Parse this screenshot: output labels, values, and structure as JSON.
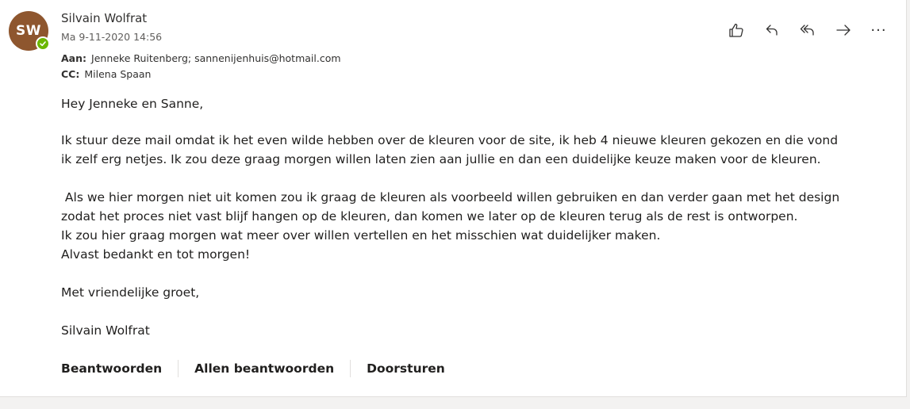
{
  "sender": {
    "initials": "SW",
    "name": "Silvain Wolfrat",
    "date": "Ma 9-11-2020 14:56",
    "avatar_color": "#8e562e",
    "presence_color": "#6bb700"
  },
  "recipients": {
    "to_label": "Aan:",
    "to": "Jenneke Ruitenberg; sannenijenhuis@hotmail.com",
    "cc_label": "CC:",
    "cc": "Milena Spaan"
  },
  "toolbar": [
    {
      "name": "like-button",
      "icon": "thumbs-up-icon"
    },
    {
      "name": "reply-button",
      "icon": "reply-icon"
    },
    {
      "name": "reply-all-button",
      "icon": "reply-all-icon"
    },
    {
      "name": "forward-button",
      "icon": "forward-arrow-icon"
    },
    {
      "name": "more-actions-button",
      "icon": "more-icon",
      "label": "···"
    }
  ],
  "message": {
    "greeting": "Hey Jenneke en Sanne,",
    "p1_line1": "Ik stuur deze mail omdat ik het even wilde hebben over de kleuren voor de site, ik heb 4 nieuwe kleuren gekozen en die vond",
    "p1_line2": "ik zelf erg netjes. Ik zou deze graag morgen willen laten zien aan jullie en dan een duidelijke keuze maken voor de kleuren.",
    "p2_line1": " Als we hier morgen niet uit komen zou ik graag de kleuren als voorbeeld willen gebruiken en dan verder gaan met het design",
    "p2_line2": "zodat het proces niet vast blijf hangen op de kleuren, dan komen we later op de kleuren terug als de rest is ontworpen.",
    "p2_line3": "Ik zou hier graag morgen wat meer over willen vertellen en het misschien wat duidelijker maken.",
    "p2_line4": "Alvast bedankt en tot morgen!",
    "closing": "Met vriendelijke groet,",
    "signature": "Silvain Wolfrat"
  },
  "footer": {
    "reply": "Beantwoorden",
    "reply_all": "Allen beantwoorden",
    "forward": "Doorsturen"
  }
}
